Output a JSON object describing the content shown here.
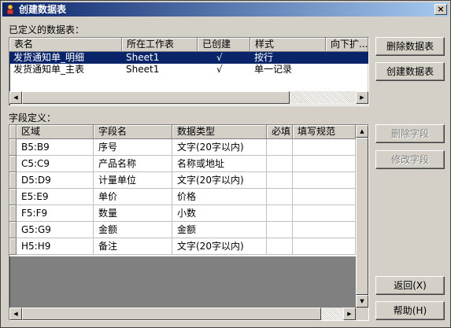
{
  "window": {
    "title": "创建数据表",
    "close_glyph": "×"
  },
  "defined_tables": {
    "label": "已定义的数据表：",
    "columns": [
      "表名",
      "所在工作表",
      "已创建",
      "样式",
      "向下扩..."
    ],
    "rows": [
      {
        "name": "发货通知单_明细",
        "sheet": "Sheet1",
        "created": "√",
        "style": "按行",
        "selected": true
      },
      {
        "name": "发货通知单_主表",
        "sheet": "Sheet1",
        "created": "√",
        "style": "单一记录",
        "selected": false
      }
    ]
  },
  "buttons": {
    "delete_table": "删除数据表",
    "create_table": "创建数据表",
    "delete_field": "删除字段",
    "edit_field": "修改字段",
    "back": "返回(X)",
    "help": "帮助(H)"
  },
  "field_def": {
    "label": "字段定义：",
    "columns": [
      "区域",
      "字段名",
      "数据类型",
      "必填",
      "填写规范"
    ],
    "rows": [
      {
        "area": "B5:B9",
        "name": "序号",
        "type": "文字(20字以内)",
        "required": "",
        "rule": ""
      },
      {
        "area": "C5:C9",
        "name": "产品名称",
        "type": "名称或地址",
        "required": "",
        "rule": ""
      },
      {
        "area": "D5:D9",
        "name": "计量单位",
        "type": "文字(20字以内)",
        "required": "",
        "rule": ""
      },
      {
        "area": "E5:E9",
        "name": "单价",
        "type": "价格",
        "required": "",
        "rule": ""
      },
      {
        "area": "F5:F9",
        "name": "数量",
        "type": "小数",
        "required": "",
        "rule": ""
      },
      {
        "area": "G5:G9",
        "name": "金额",
        "type": "金额",
        "required": "",
        "rule": ""
      },
      {
        "area": "H5:H9",
        "name": "备注",
        "type": "文字(20字以内)",
        "required": "",
        "rule": ""
      }
    ]
  }
}
